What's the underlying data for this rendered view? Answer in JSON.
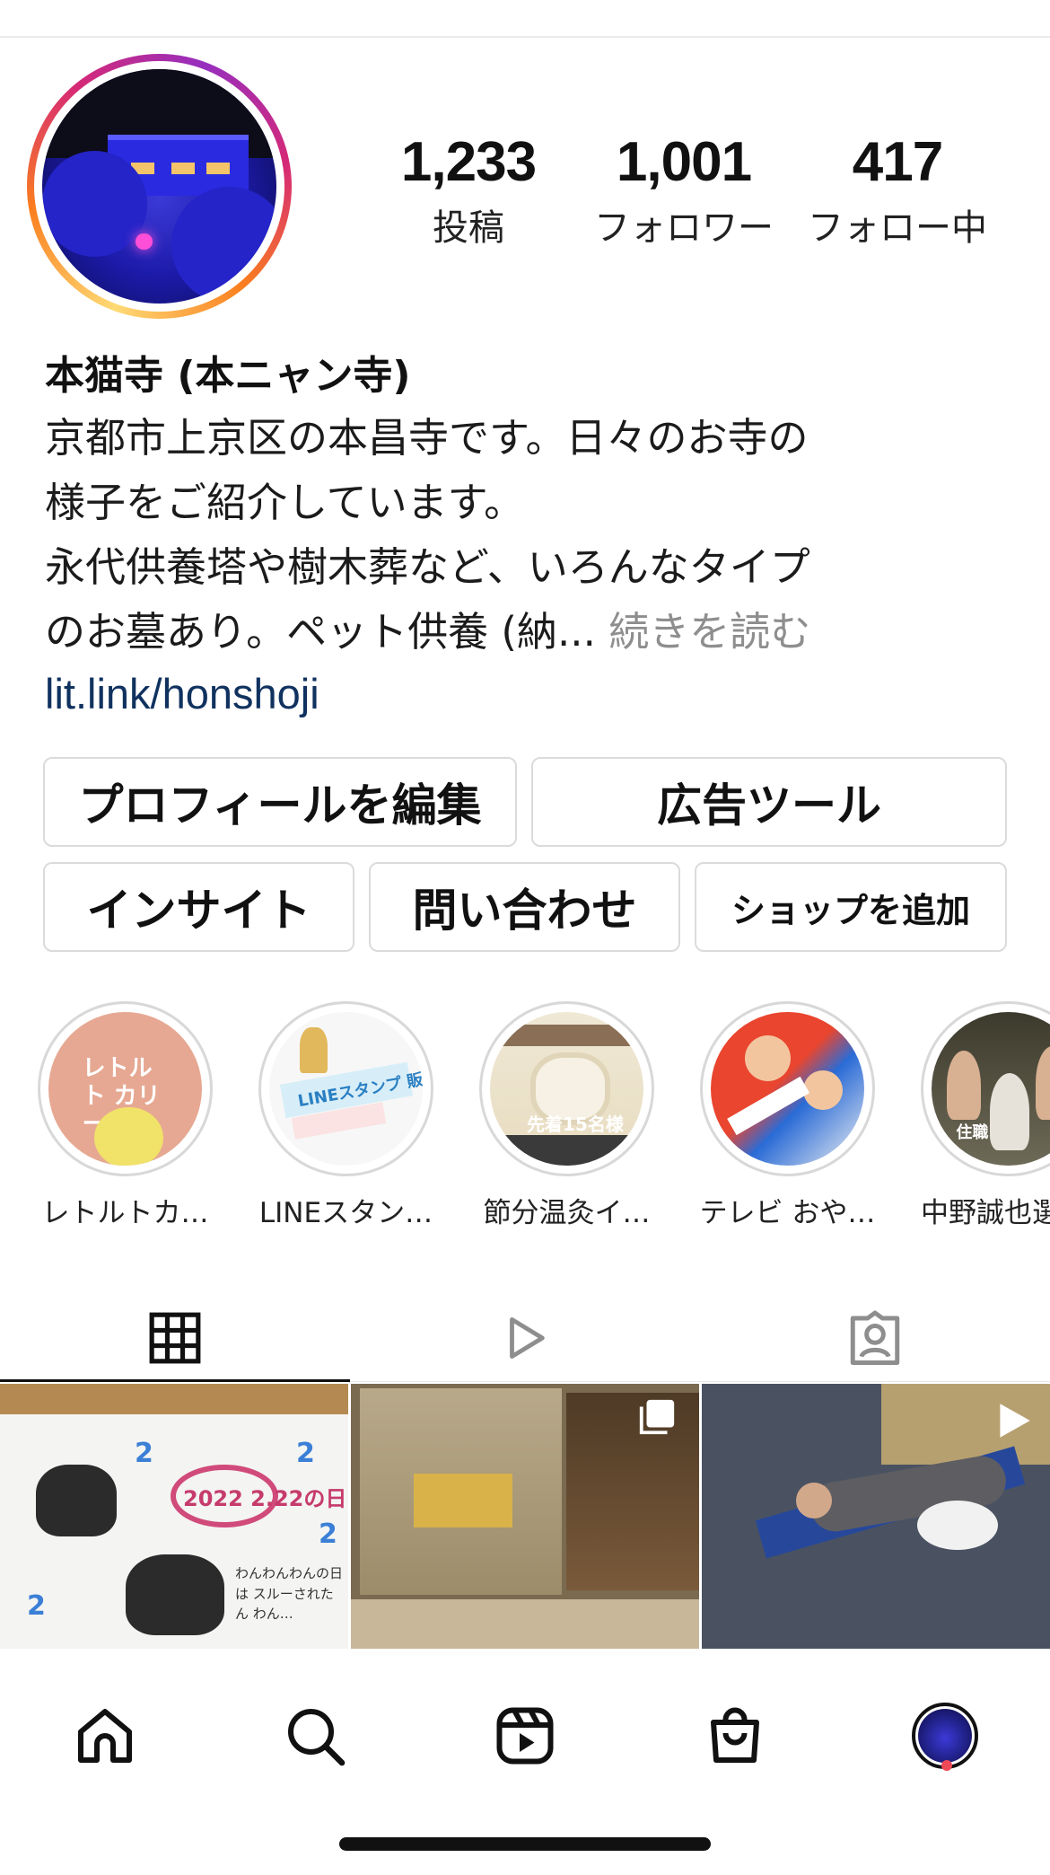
{
  "profile": {
    "name": "本猫寺 (本ニャン寺)",
    "stats": [
      {
        "value": "1,233",
        "label": "投稿"
      },
      {
        "value": "1,001",
        "label": "フォロワー"
      },
      {
        "value": "417",
        "label": "フォロー中"
      }
    ],
    "bio_lines": [
      "京都市上京区の本昌寺です。日々のお寺の",
      "様子をご紹介しています。",
      "永代供養塔や樹木葬など、いろんなタイプ",
      "のお墓あり。ペット供養 (納..."
    ],
    "bio_more": "続きを読む",
    "link": "lit.link/honshoji"
  },
  "actions": {
    "edit_profile": "プロフィールを編集",
    "ad_tools": "広告ツール",
    "insights": "インサイト",
    "contact": "問い合わせ",
    "add_shop": "ショップを追加"
  },
  "highlights": [
    {
      "label": "レトルトカ…",
      "thumb_text": "レトルト カリー寺"
    },
    {
      "label": "LINEスタン…",
      "thumb_text": "LINEスタンプ 販売中!!"
    },
    {
      "label": "節分温灸イ…",
      "thumb_text": "先着15名様"
    },
    {
      "label": "テレビ おや…",
      "thumb_text": ""
    },
    {
      "label": "中野誠也選",
      "thumb_text": "住職"
    }
  ],
  "tabs": [
    "grid-tab",
    "reels-tab",
    "tagged-tab"
  ],
  "grid": {
    "post1_text": "2022 2.22の日",
    "post1_caption": "わんわんわんの日は スルーされたん わん…"
  },
  "nav": [
    "home",
    "search",
    "reels",
    "shop",
    "profile"
  ],
  "colors": {
    "link": "#10325f",
    "more": "#8e8e8e",
    "notification_dot": "#ed4956",
    "border": "#dbdbdb"
  }
}
